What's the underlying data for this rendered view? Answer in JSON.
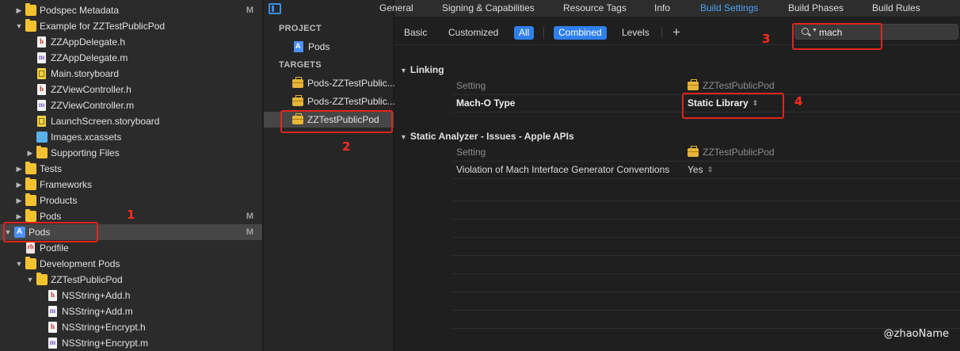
{
  "navigator": {
    "items": [
      {
        "label": "Podspec Metadata",
        "icon": "folder-icon",
        "disclosure": "▶",
        "badge": "M"
      },
      {
        "label": "Example for ZZTestPublicPod",
        "icon": "folder-icon",
        "disclosure": "▼",
        "badge": ""
      },
      {
        "label": "ZZAppDelegate.h",
        "icon": "header-file-icon",
        "glyph": "h",
        "disclosure": "",
        "badge": ""
      },
      {
        "label": "ZZAppDelegate.m",
        "icon": "implementation-file-icon",
        "glyph": "m",
        "disclosure": "",
        "badge": ""
      },
      {
        "label": "Main.storyboard",
        "icon": "storyboard-icon",
        "disclosure": "",
        "badge": ""
      },
      {
        "label": "ZZViewController.h",
        "icon": "header-file-icon",
        "glyph": "h",
        "disclosure": "",
        "badge": ""
      },
      {
        "label": "ZZViewController.m",
        "icon": "implementation-file-icon",
        "glyph": "m",
        "disclosure": "",
        "badge": ""
      },
      {
        "label": "LaunchScreen.storyboard",
        "icon": "storyboard-icon",
        "disclosure": "",
        "badge": ""
      },
      {
        "label": "Images.xcassets",
        "icon": "asset-catalog-icon",
        "disclosure": "",
        "badge": ""
      },
      {
        "label": "Supporting Files",
        "icon": "folder-icon",
        "disclosure": "▶",
        "badge": ""
      },
      {
        "label": "Tests",
        "icon": "folder-icon",
        "disclosure": "▶",
        "badge": ""
      },
      {
        "label": "Frameworks",
        "icon": "folder-icon",
        "disclosure": "▶",
        "badge": ""
      },
      {
        "label": "Products",
        "icon": "folder-icon",
        "disclosure": "▶",
        "badge": ""
      },
      {
        "label": "Pods",
        "icon": "folder-icon",
        "disclosure": "▶",
        "badge": "M"
      },
      {
        "label": "Pods",
        "icon": "xcode-project-icon",
        "disclosure": "▼",
        "badge": "M",
        "selected": true
      },
      {
        "label": "Podfile",
        "icon": "ruby-file-icon",
        "glyph": "rb",
        "disclosure": "",
        "badge": ""
      },
      {
        "label": "Development Pods",
        "icon": "folder-icon",
        "disclosure": "▼",
        "badge": ""
      },
      {
        "label": "ZZTestPublicPod",
        "icon": "folder-icon",
        "disclosure": "▼",
        "badge": ""
      },
      {
        "label": "NSString+Add.h",
        "icon": "header-file-icon",
        "glyph": "h",
        "disclosure": "",
        "badge": ""
      },
      {
        "label": "NSString+Add.m",
        "icon": "implementation-file-icon",
        "glyph": "m",
        "disclosure": "",
        "badge": ""
      },
      {
        "label": "NSString+Encrypt.h",
        "icon": "header-file-icon",
        "glyph": "h",
        "disclosure": "",
        "badge": ""
      },
      {
        "label": "NSString+Encrypt.m",
        "icon": "implementation-file-icon",
        "glyph": "m",
        "disclosure": "",
        "badge": ""
      }
    ]
  },
  "targets_pane": {
    "project_header": "PROJECT",
    "project_item": "Pods",
    "targets_header": "TARGETS",
    "targets": [
      {
        "label": "Pods-ZZTestPublic..."
      },
      {
        "label": "Pods-ZZTestPublic..."
      },
      {
        "label": "ZZTestPublicPod",
        "selected": true
      }
    ]
  },
  "tabs": [
    {
      "label": "General"
    },
    {
      "label": "Signing & Capabilities"
    },
    {
      "label": "Resource Tags"
    },
    {
      "label": "Info"
    },
    {
      "label": "Build Settings",
      "active": true
    },
    {
      "label": "Build Phases"
    },
    {
      "label": "Build Rules"
    }
  ],
  "filter": {
    "basic": "Basic",
    "customized": "Customized",
    "all": "All",
    "combined": "Combined",
    "levels": "Levels",
    "add": "+",
    "search_value": "mach"
  },
  "settings": {
    "linking": {
      "title": "Linking",
      "setting_label": "Setting",
      "target_name": "ZZTestPublicPod",
      "key": "Mach-O Type",
      "value": "Static Library"
    },
    "analyzer": {
      "title": "Static Analyzer - Issues - Apple APIs",
      "setting_label": "Setting",
      "target_name": "ZZTestPublicPod",
      "key": "Violation of Mach Interface Generator Conventions",
      "value": "Yes"
    }
  },
  "annotations": {
    "n1": "1",
    "n2": "2",
    "n3": "3",
    "n4": "4",
    "watermark": "@zhaoName",
    "color": "#e0261c"
  },
  "colors": {
    "accent": "#2f80ed",
    "active_tab": "#4aa3f5",
    "folder": "#f2c230"
  }
}
